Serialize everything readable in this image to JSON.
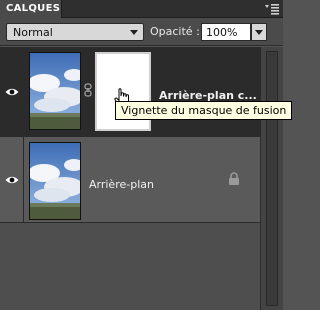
{
  "panel": {
    "tab_label": "CALQUES",
    "menu_icon": "panel-menu-icon"
  },
  "options": {
    "blend_mode": "Normal",
    "opacity_label": "Opacité :",
    "opacity_value": "100%"
  },
  "layers": [
    {
      "name": "Arrière-plan c...",
      "visible": true,
      "selected": true,
      "has_mask": true,
      "locked": false
    },
    {
      "name": "Arrière-plan",
      "visible": true,
      "selected": false,
      "has_mask": false,
      "locked": true
    }
  ],
  "tooltip": {
    "text": "Vignette du masque de fusion"
  },
  "colors": {
    "panel_bg": "#4e4e4e",
    "selected_row": "#2b2b2b",
    "tooltip_bg": "#ffffe1"
  }
}
